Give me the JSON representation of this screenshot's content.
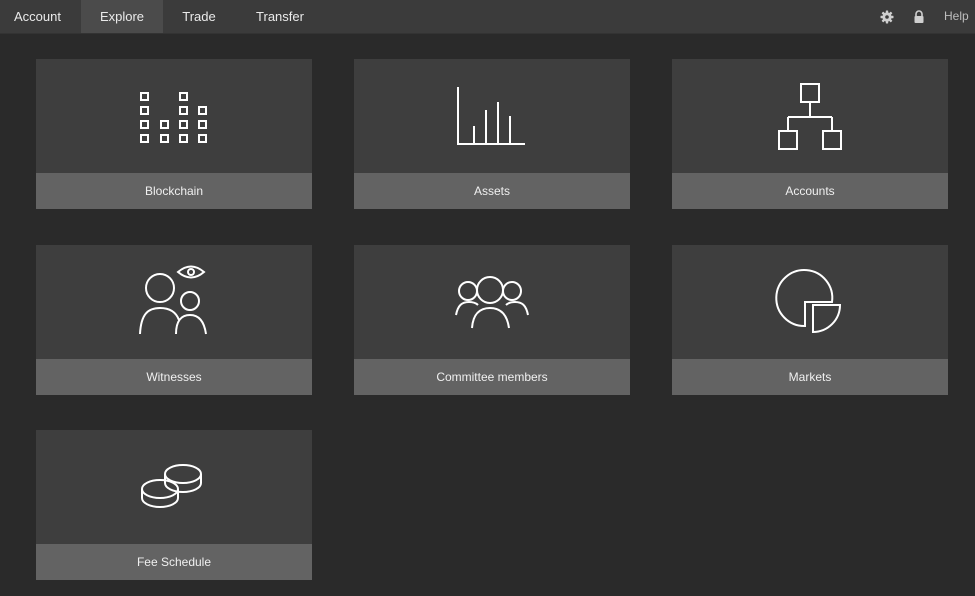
{
  "nav": {
    "items": [
      {
        "label": "Account"
      },
      {
        "label": "Explore",
        "active": true
      },
      {
        "label": "Trade"
      },
      {
        "label": "Transfer"
      }
    ],
    "help_label": "Help"
  },
  "tiles": [
    {
      "label": "Blockchain",
      "icon": "blockchain-icon"
    },
    {
      "label": "Assets",
      "icon": "assets-chart-icon"
    },
    {
      "label": "Accounts",
      "icon": "accounts-hierarchy-icon"
    },
    {
      "label": "Witnesses",
      "icon": "witnesses-icon"
    },
    {
      "label": "Committee members",
      "icon": "committee-members-icon"
    },
    {
      "label": "Markets",
      "icon": "markets-pie-icon"
    },
    {
      "label": "Fee Schedule",
      "icon": "fee-schedule-coins-icon"
    }
  ],
  "colors": {
    "background": "#2a2a2a",
    "topbar": "#3b3b3b",
    "active_tab": "#4b4b4b",
    "tile": "#3e3e3e",
    "tile_label_bar": "#636363",
    "icon_stroke": "#ffffff"
  }
}
